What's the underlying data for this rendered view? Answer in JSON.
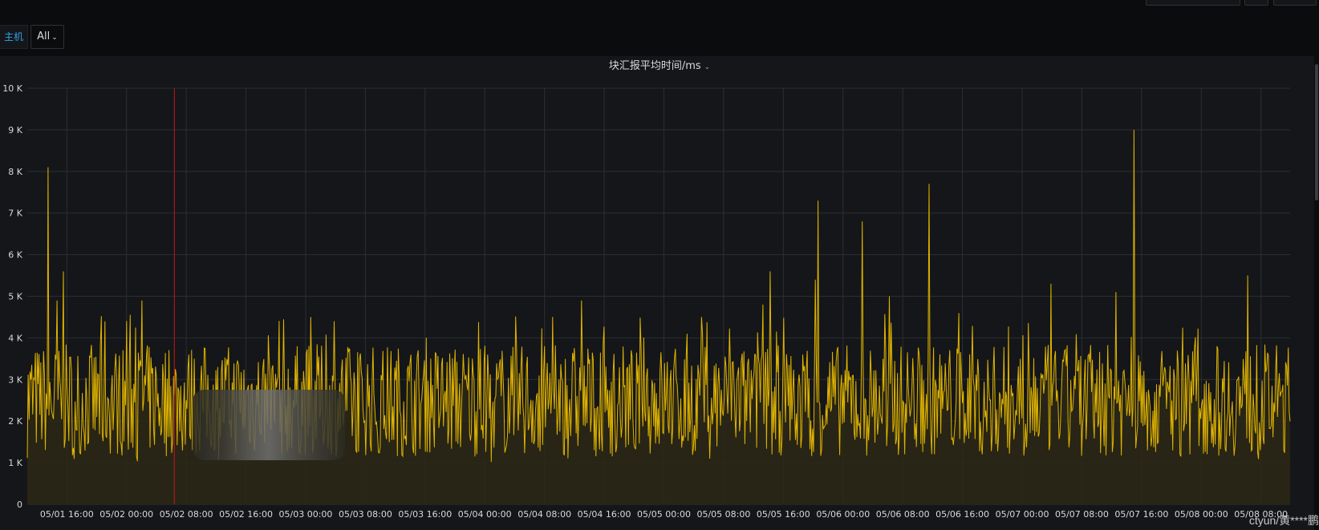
{
  "variables": {
    "label": "主机",
    "value": "All"
  },
  "panel": {
    "title": "块汇报平均时间/ms"
  },
  "watermark": "ctyun/黄****鹏",
  "colors": {
    "series": "#e0b400",
    "fill": "#2b2816",
    "grid": "#2c2f33",
    "marker": "#c4161c"
  },
  "chart_data": {
    "type": "line",
    "title": "块汇报平均时间/ms",
    "xlabel": "",
    "ylabel": "",
    "ylim": [
      0,
      10000
    ],
    "yticks": [
      {
        "value": 0,
        "label": "0"
      },
      {
        "value": 1000,
        "label": "1 K"
      },
      {
        "value": 2000,
        "label": "2 K"
      },
      {
        "value": 3000,
        "label": "3 K"
      },
      {
        "value": 4000,
        "label": "4 K"
      },
      {
        "value": 5000,
        "label": "5 K"
      },
      {
        "value": 6000,
        "label": "6 K"
      },
      {
        "value": 7000,
        "label": "7 K"
      },
      {
        "value": 8000,
        "label": "8 K"
      },
      {
        "value": 9000,
        "label": "9 K"
      },
      {
        "value": 10000,
        "label": "10 K"
      }
    ],
    "x_range_hours": [
      -5.3,
      163.9
    ],
    "x_reference": "05/01 16:00",
    "xticks": [
      {
        "hour": 0,
        "label": "05/01 16:00"
      },
      {
        "hour": 8,
        "label": "05/02 00:00"
      },
      {
        "hour": 16,
        "label": "05/02 08:00"
      },
      {
        "hour": 24,
        "label": "05/02 16:00"
      },
      {
        "hour": 32,
        "label": "05/03 00:00"
      },
      {
        "hour": 40,
        "label": "05/03 08:00"
      },
      {
        "hour": 48,
        "label": "05/03 16:00"
      },
      {
        "hour": 56,
        "label": "05/04 00:00"
      },
      {
        "hour": 64,
        "label": "05/04 08:00"
      },
      {
        "hour": 72,
        "label": "05/04 16:00"
      },
      {
        "hour": 80,
        "label": "05/05 00:00"
      },
      {
        "hour": 88,
        "label": "05/05 08:00"
      },
      {
        "hour": 96,
        "label": "05/05 16:00"
      },
      {
        "hour": 104,
        "label": "05/06 00:00"
      },
      {
        "hour": 112,
        "label": "05/06 08:00"
      },
      {
        "hour": 120,
        "label": "05/06 16:00"
      },
      {
        "hour": 128,
        "label": "05/07 00:00"
      },
      {
        "hour": 136,
        "label": "05/07 08:00"
      },
      {
        "hour": 144,
        "label": "05/07 16:00"
      },
      {
        "hour": 152,
        "label": "05/08 00:00"
      },
      {
        "hour": 160,
        "label": "05/08 08:00"
      }
    ],
    "marker_hour": 14.4,
    "baseline_low": 1000,
    "baseline_typical": 2500,
    "baseline_high": 4000,
    "spikes": [
      {
        "hour": -2.5,
        "value": 8100
      },
      {
        "hour": -1.3,
        "value": 4900
      },
      {
        "hour": -0.5,
        "value": 5600
      },
      {
        "hour": 5.1,
        "value": 4400
      },
      {
        "hour": 10.1,
        "value": 4900
      },
      {
        "hour": 32.7,
        "value": 4500
      },
      {
        "hour": 35.8,
        "value": 4400
      },
      {
        "hour": 69.0,
        "value": 4900
      },
      {
        "hour": 85.0,
        "value": 4500
      },
      {
        "hour": 93.3,
        "value": 4800
      },
      {
        "hour": 94.2,
        "value": 5600
      },
      {
        "hour": 100.3,
        "value": 5400
      },
      {
        "hour": 100.6,
        "value": 7300
      },
      {
        "hour": 106.6,
        "value": 6800
      },
      {
        "hour": 110.2,
        "value": 5000
      },
      {
        "hour": 115.5,
        "value": 7700
      },
      {
        "hour": 131.8,
        "value": 5300
      },
      {
        "hour": 140.5,
        "value": 5100
      },
      {
        "hour": 143.0,
        "value": 9000
      },
      {
        "hour": 158.2,
        "value": 5500
      }
    ],
    "series": [
      {
        "name": "",
        "color": "#e0b400"
      }
    ]
  }
}
